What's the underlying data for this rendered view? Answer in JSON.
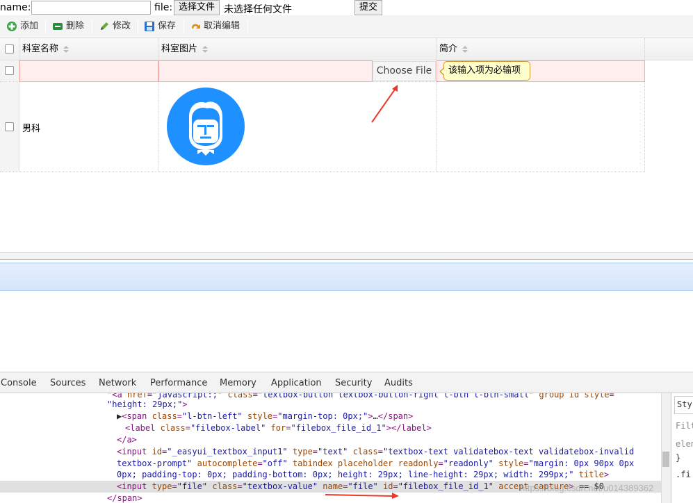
{
  "form": {
    "name_label": "name:",
    "name_value": "",
    "file_label": "file:",
    "choose_file_label": "选择文件",
    "no_file_text": "未选择任何文件",
    "submit_label": "提交"
  },
  "toolbar": {
    "add": "添加",
    "delete": "删除",
    "edit": "修改",
    "save": "保存",
    "cancel_edit": "取消编辑",
    "icons": [
      "add-icon",
      "remove-icon",
      "edit-icon",
      "save-icon",
      "undo-icon"
    ]
  },
  "grid": {
    "columns": [
      "科室名称",
      "科室图片",
      "简介"
    ],
    "edit_row": {
      "choose_file_label": "Choose File",
      "tooltip": "该输入项为必输项"
    },
    "rows": [
      {
        "name": "男科",
        "image": "department-avatar-icon",
        "intro": ""
      }
    ]
  },
  "devtools": {
    "tabs": [
      "Console",
      "Sources",
      "Network",
      "Performance",
      "Memory",
      "Application",
      "Security",
      "Audits"
    ],
    "side_items": [
      "Sty",
      "Filte",
      "elen",
      "}",
      ".fi"
    ],
    "watermark": "https://blog.csdn.net/u014389362"
  },
  "colors": {
    "accent_blue": "#1e90ff",
    "error_bg": "#ffeeee",
    "error_border": "#ffa8a8",
    "tooltip_bg": "#ffffcc",
    "arrow_red": "#e8392c"
  }
}
